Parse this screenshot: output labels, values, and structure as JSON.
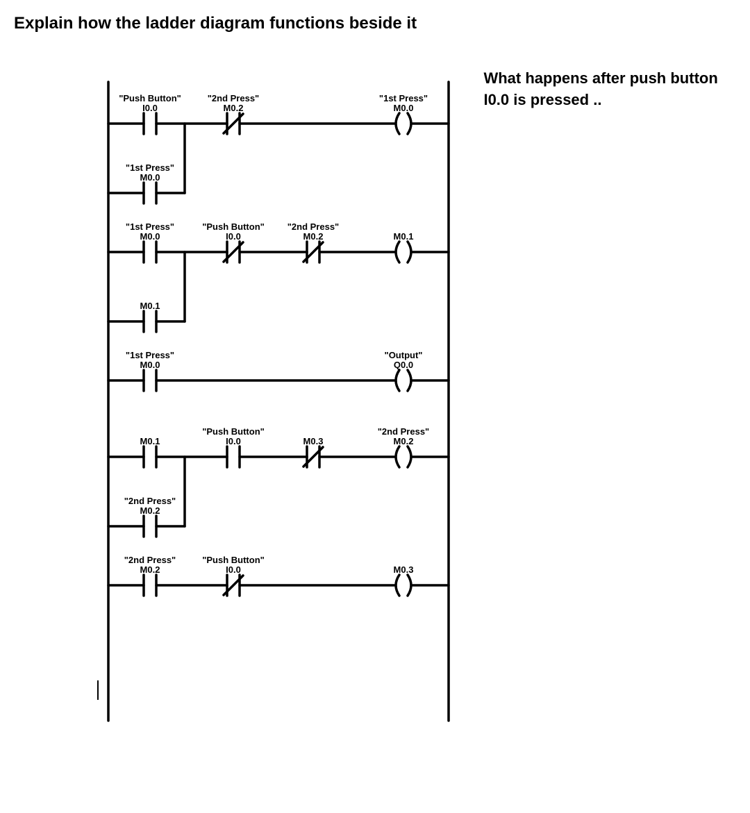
{
  "title": "Explain how the ladder diagram functions beside it",
  "side_question": "What happens after push button I0.0 is pressed ..",
  "diagram": {
    "rungs": [
      {
        "elements": [
          {
            "type": "no",
            "label1": "\"Push Button\"",
            "label2": "I0.0"
          },
          {
            "type": "nc",
            "label1": "\"2nd Press\"",
            "label2": "M0.2"
          },
          {
            "type": "coil",
            "label1": "\"1st Press\"",
            "label2": "M0.0"
          }
        ],
        "branch": [
          {
            "type": "no",
            "label1": "\"1st Press\"",
            "label2": "M0.0"
          }
        ]
      },
      {
        "elements": [
          {
            "type": "no",
            "label1": "\"1st Press\"",
            "label2": "M0.0"
          },
          {
            "type": "nc",
            "label1": "\"Push Button\"",
            "label2": "I0.0"
          },
          {
            "type": "nc",
            "label1": "\"2nd Press\"",
            "label2": "M0.2"
          },
          {
            "type": "coil",
            "label1": "",
            "label2": "M0.1"
          }
        ],
        "branch": [
          {
            "type": "no",
            "label1": "",
            "label2": "M0.1"
          }
        ]
      },
      {
        "elements": [
          {
            "type": "no",
            "label1": "\"1st Press\"",
            "label2": "M0.0"
          },
          {
            "type": "coil",
            "label1": "\"Output\"",
            "label2": "Q0.0"
          }
        ]
      },
      {
        "elements": [
          {
            "type": "no",
            "label1": "",
            "label2": "M0.1"
          },
          {
            "type": "no",
            "label1": "\"Push Button\"",
            "label2": "I0.0"
          },
          {
            "type": "nc",
            "label1": "",
            "label2": "M0.3"
          },
          {
            "type": "coil",
            "label1": "\"2nd Press\"",
            "label2": "M0.2"
          }
        ],
        "branch": [
          {
            "type": "no",
            "label1": "\"2nd Press\"",
            "label2": "M0.2"
          }
        ]
      },
      {
        "elements": [
          {
            "type": "no",
            "label1": "\"2nd Press\"",
            "label2": "M0.2"
          },
          {
            "type": "nc",
            "label1": "\"Push Button\"",
            "label2": "I0.0"
          },
          {
            "type": "coil",
            "label1": "",
            "label2": "M0.3"
          }
        ]
      }
    ]
  }
}
